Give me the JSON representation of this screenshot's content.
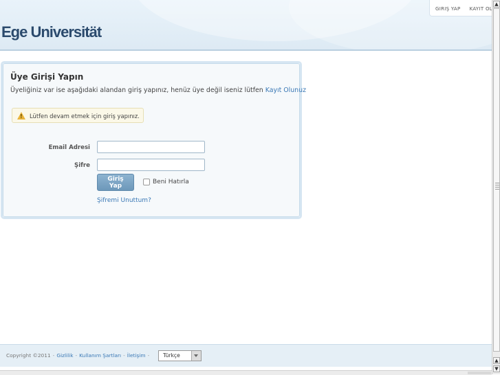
{
  "header": {
    "site_title": "Ege Universität",
    "nav": {
      "login": "GIRIŞ YAP",
      "register": "KAYIT OL"
    }
  },
  "login": {
    "title": "Üye Girişi Yapın",
    "description": "Üyeliğiniz var ise aşağıdaki alandan giriş yapınız, henüz üye değil iseniz lütfen",
    "register_link": "Kayıt Olunuz",
    "warning_icon": "warning-icon",
    "warning": "Lütfen devam etmek için giriş yapınız.",
    "email_label": "Email Adresi",
    "email_value": "",
    "password_label": "Şifre",
    "password_value": "",
    "submit": "Giriş Yap",
    "remember_label": "Beni Hatırla",
    "remember_checked": false,
    "forgot": "Şifremi Unuttum?"
  },
  "footer": {
    "copyright": "Copyright ©2011",
    "privacy": "Gizlilik",
    "terms": "Kullanım Şartları",
    "contact": "İletişim",
    "language": "Türkçe"
  },
  "colors": {
    "accent": "#3a78b5",
    "button": "#7aa3c4",
    "header_bg": "#e3eef7",
    "title": "#2b4a6d"
  }
}
